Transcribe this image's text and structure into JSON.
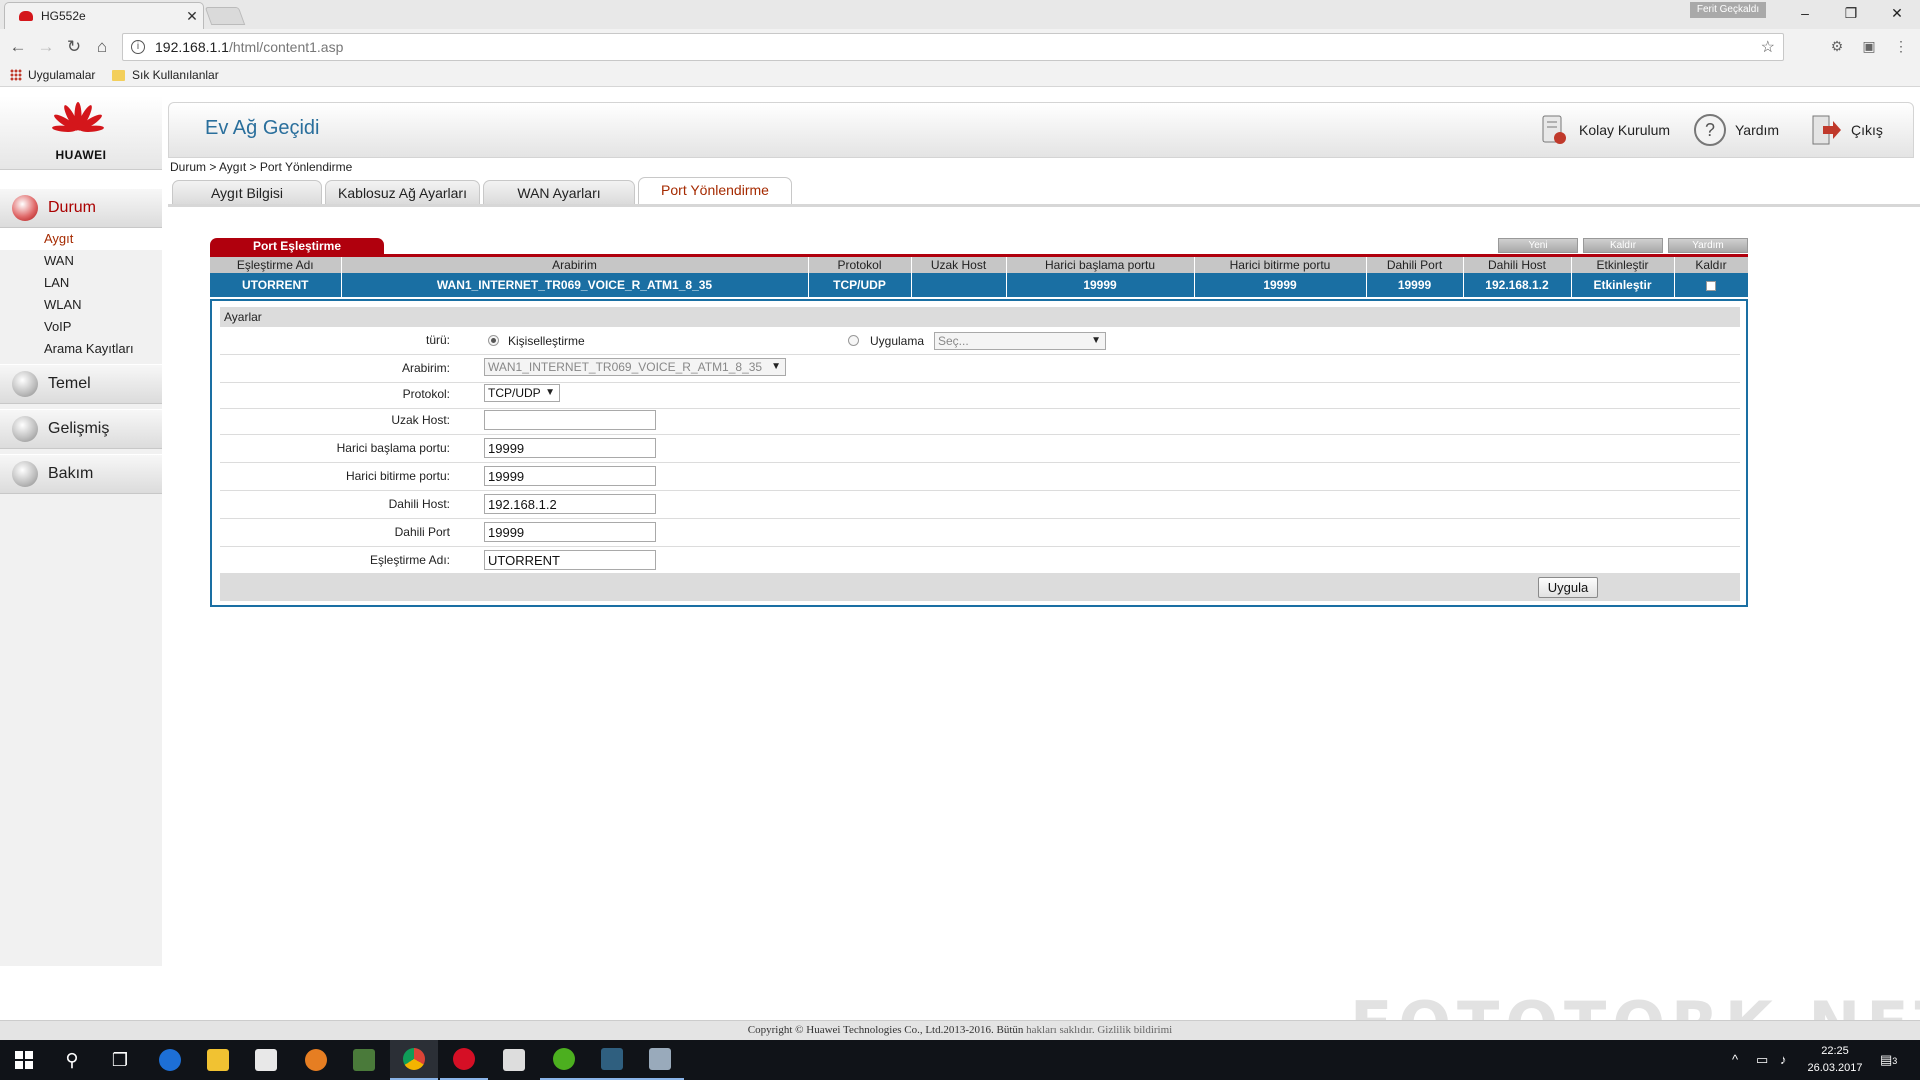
{
  "browser": {
    "tab_title": "HG552e",
    "profile": "Ferit Geçkaldı",
    "url_host": "192.168.1.1",
    "url_path": "/html/content1.asp",
    "bookmarks": [
      "Uygulamalar",
      "Sık Kullanılanlar"
    ]
  },
  "brand": {
    "logo_text": "HUAWEI"
  },
  "header": {
    "title": "Ev Ağ Geçidi",
    "buttons": [
      {
        "label": "Kolay Kurulum",
        "icon": "wizard-icon"
      },
      {
        "label": "Yardım",
        "icon": "help-icon"
      },
      {
        "label": "Çıkış",
        "icon": "exit-icon"
      }
    ]
  },
  "breadcrumb": "Durum > Aygıt > Port Yönlendirme",
  "tabs": [
    "Aygıt Bilgisi",
    "Kablosuz Ağ Ayarları",
    "WAN Ayarları",
    "Port Yönlendirme"
  ],
  "active_tab": "Port Yönlendirme",
  "sidebar": {
    "main": [
      "Durum",
      "Temel",
      "Gelişmiş",
      "Bakım"
    ],
    "sub": [
      "Aygıt",
      "WAN",
      "LAN",
      "WLAN",
      "VoIP",
      "Arama Kayıtları"
    ],
    "active_main": "Durum",
    "active_sub": "Aygıt"
  },
  "mapping": {
    "section_title": "Port Eşleştirme",
    "actions": [
      "Yeni",
      "Kaldır",
      "Yardım"
    ],
    "columns": [
      "Eşleştirme Adı",
      "Arabirim",
      "Protokol",
      "Uzak Host",
      "Harici başlama portu",
      "Harici bitirme portu",
      "Dahili Port",
      "Dahili Host",
      "Etkinleştir",
      "Kaldır"
    ],
    "rows": [
      [
        "UTORRENT",
        "WAN1_INTERNET_TR069_VOICE_R_ATM1_8_35",
        "TCP/UDP",
        "",
        "19999",
        "19999",
        "19999",
        "192.168.1.2",
        "Etkinleştir",
        ""
      ]
    ]
  },
  "settings": {
    "title": "Ayarlar",
    "type_label": "türü:",
    "type_options": [
      "Kişiselleştirme",
      "Uygulama"
    ],
    "type_selected": "Kişiselleştirme",
    "app_select_placeholder": "Seç...",
    "interface_label": "Arabirim:",
    "interface_value": "WAN1_INTERNET_TR069_VOICE_R_ATM1_8_35",
    "protocol_label": "Protokol:",
    "protocol_value": "TCP/UDP",
    "remote_host_label": "Uzak Host:",
    "remote_host_value": "",
    "ext_start_label": "Harici başlama portu:",
    "ext_start_value": "19999",
    "ext_end_label": "Harici bitirme portu:",
    "ext_end_value": "19999",
    "int_host_label": "Dahili Host:",
    "int_host_value": "192.168.1.2",
    "int_port_label": "Dahili Port",
    "int_port_value": "19999",
    "name_label": "Eşleştirme Adı:",
    "name_value": "UTORRENT",
    "apply_label": "Uygula"
  },
  "footer": {
    "copyright": "Copyright © Huawei Technologies Co., Ltd.2013-2016. Bütün",
    "rights_link": "hakları saklıdır.",
    "privacy_link": "Gizlilik bildirimi"
  },
  "watermark": "FOTOTORK.NET",
  "taskbar": {
    "time": "22:25",
    "date": "26.03.2017",
    "notification_count": "3"
  },
  "colors": {
    "accent_blue": "#1a6fa3",
    "accent_red": "#b0000d",
    "title_blue": "#2a6f9c"
  }
}
